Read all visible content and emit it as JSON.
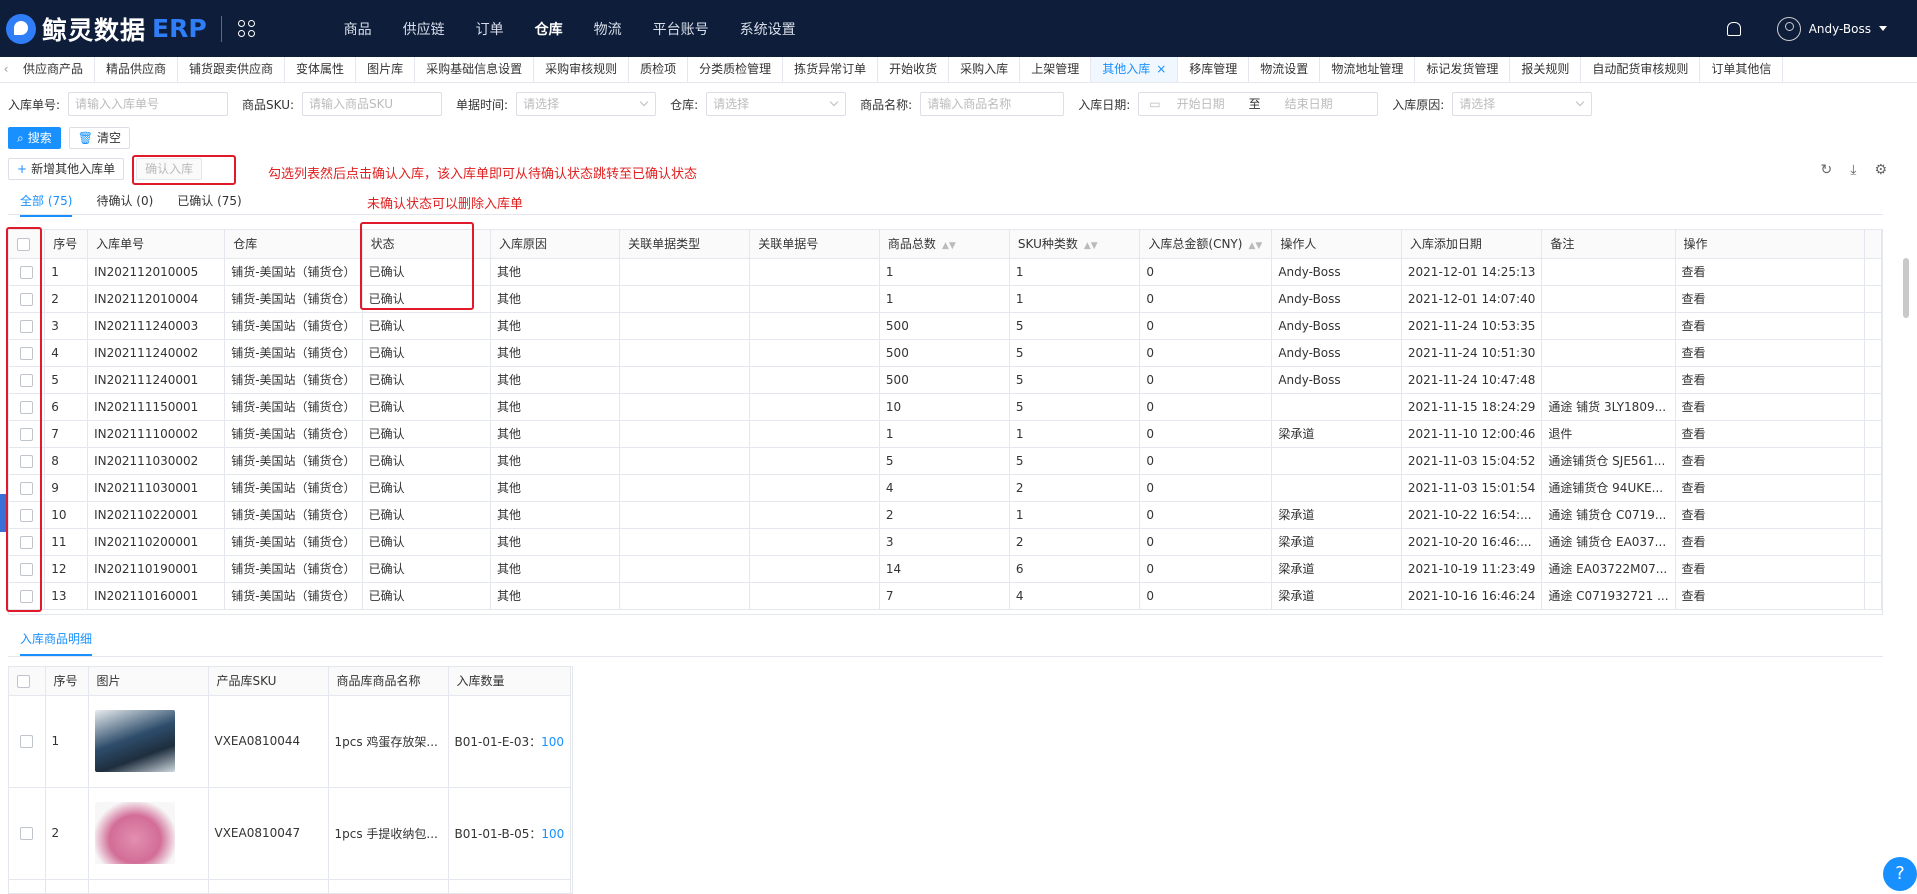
{
  "header": {
    "brand": "鲸灵数据",
    "brand_suffix": "ERP",
    "nav": [
      "商品",
      "供应链",
      "订单",
      "仓库",
      "物流",
      "平台账号",
      "系统设置"
    ],
    "active_nav": "仓库",
    "user": "Andy-Boss"
  },
  "tabs": [
    "供应商产品",
    "精品供应商",
    "铺货跟卖供应商",
    "变体属性",
    "图片库",
    "采购基础信息设置",
    "采购审核规则",
    "质检项",
    "分类质检管理",
    "拣货异常订单",
    "开始收货",
    "采购入库",
    "上架管理",
    "其他入库",
    "移库管理",
    "物流设置",
    "物流地址管理",
    "标记发货管理",
    "报关规则",
    "自动配货审核规则",
    "订单其他信"
  ],
  "active_tab": "其他入库",
  "filters": {
    "inbound_no_label": "入库单号:",
    "inbound_no_placeholder": "请输入入库单号",
    "sku_label": "商品SKU:",
    "sku_placeholder": "请输入商品SKU",
    "doc_time_label": "单据时间:",
    "doc_time_placeholder": "请选择",
    "warehouse_label": "仓库:",
    "warehouse_placeholder": "请选择",
    "product_name_label": "商品名称:",
    "product_name_placeholder": "请输入商品名称",
    "inbound_date_label": "入库日期:",
    "start_date_placeholder": "开始日期",
    "date_sep": "至",
    "end_date_placeholder": "结束日期",
    "reason_label": "入库原因:",
    "reason_placeholder": "请选择"
  },
  "buttons": {
    "search": "搜索",
    "clear": "清空",
    "add": "新增其他入库单",
    "confirm": "确认入库"
  },
  "annotations": {
    "confirm_note": "勾选列表然后点击确认入库，该入库单即可从待确认状态跳转至已确认状态",
    "delete_note": "未确认状态可以删除入库单"
  },
  "subtabs": [
    "全部 (75)",
    "待确认 (0)",
    "已确认 (75)"
  ],
  "table": {
    "columns": [
      "序号",
      "入库单号",
      "仓库",
      "状态",
      "入库原因",
      "关联单据类型",
      "关联单据号",
      "商品总数",
      "SKU种类数",
      "入库总金额(CNY)",
      "操作人",
      "入库添加日期",
      "备注",
      "操作"
    ],
    "rows": [
      [
        "1",
        "IN202112010005",
        "铺货-美国站（铺货仓）",
        "已确认",
        "其他",
        "",
        "",
        "1",
        "1",
        "0",
        "Andy-Boss",
        "2021-12-01 14:25:13",
        "",
        "查看"
      ],
      [
        "2",
        "IN202112010004",
        "铺货-美国站（铺货仓）",
        "已确认",
        "其他",
        "",
        "",
        "1",
        "1",
        "0",
        "Andy-Boss",
        "2021-12-01 14:07:40",
        "",
        "查看"
      ],
      [
        "3",
        "IN202111240003",
        "铺货-美国站（铺货仓）",
        "已确认",
        "其他",
        "",
        "",
        "500",
        "5",
        "0",
        "Andy-Boss",
        "2021-11-24 10:53:35",
        "",
        "查看"
      ],
      [
        "4",
        "IN202111240002",
        "铺货-美国站（铺货仓）",
        "已确认",
        "其他",
        "",
        "",
        "500",
        "5",
        "0",
        "Andy-Boss",
        "2021-11-24 10:51:30",
        "",
        "查看"
      ],
      [
        "5",
        "IN202111240001",
        "铺货-美国站（铺货仓）",
        "已确认",
        "其他",
        "",
        "",
        "500",
        "5",
        "0",
        "Andy-Boss",
        "2021-11-24 10:47:48",
        "",
        "查看"
      ],
      [
        "6",
        "IN202111150001",
        "铺货-美国站（铺货仓）",
        "已确认",
        "其他",
        "",
        "",
        "10",
        "5",
        "0",
        "",
        "2021-11-15 18:24:29",
        "通途 铺货 3LY1809...",
        "查看"
      ],
      [
        "7",
        "IN202111100002",
        "铺货-美国站（铺货仓）",
        "已确认",
        "其他",
        "",
        "",
        "1",
        "1",
        "0",
        "梁承道",
        "2021-11-10 12:00:46",
        "退件",
        "查看"
      ],
      [
        "8",
        "IN202111030002",
        "铺货-美国站（铺货仓）",
        "已确认",
        "其他",
        "",
        "",
        "5",
        "5",
        "0",
        "",
        "2021-11-03 15:04:52",
        "通途铺货仓 SJE561...",
        "查看"
      ],
      [
        "9",
        "IN202111030001",
        "铺货-美国站（铺货仓）",
        "已确认",
        "其他",
        "",
        "",
        "4",
        "2",
        "0",
        "",
        "2021-11-03 15:01:54",
        "通途铺货仓 94UKE...",
        "查看"
      ],
      [
        "10",
        "IN202110220001",
        "铺货-美国站（铺货仓）",
        "已确认",
        "其他",
        "",
        "",
        "2",
        "1",
        "0",
        "梁承道",
        "2021-10-22 16:54:...",
        "通途 铺货仓 C0719...",
        "查看"
      ],
      [
        "11",
        "IN202110200001",
        "铺货-美国站（铺货仓）",
        "已确认",
        "其他",
        "",
        "",
        "3",
        "2",
        "0",
        "梁承道",
        "2021-10-20 16:46:...",
        "通途 铺货仓 EA037...",
        "查看"
      ],
      [
        "12",
        "IN202110190001",
        "铺货-美国站（铺货仓）",
        "已确认",
        "其他",
        "",
        "",
        "14",
        "6",
        "0",
        "梁承道",
        "2021-10-19 11:23:49",
        "通途 EA03722M07...",
        "查看"
      ],
      [
        "13",
        "IN202110160001",
        "铺货-美国站（铺货仓）",
        "已确认",
        "其他",
        "",
        "",
        "7",
        "4",
        "0",
        "梁承道",
        "2021-10-16 16:46:24",
        "通途 C071932721 ...",
        "查看"
      ]
    ]
  },
  "detail": {
    "tab": "入库商品明细",
    "columns": [
      "序号",
      "图片",
      "产品库SKU",
      "商品库商品名称",
      "入库数量"
    ],
    "rows": [
      {
        "no": "1",
        "sku": "VXEA0810044",
        "name": "1pcs 鸡蛋存放架...",
        "loc": "B01-01-E-03：",
        "qty": "100"
      },
      {
        "no": "2",
        "sku": "VXEA0810047",
        "name": "1pcs 手提收纳包...",
        "loc": "B01-01-B-05：",
        "qty": "100"
      }
    ]
  }
}
